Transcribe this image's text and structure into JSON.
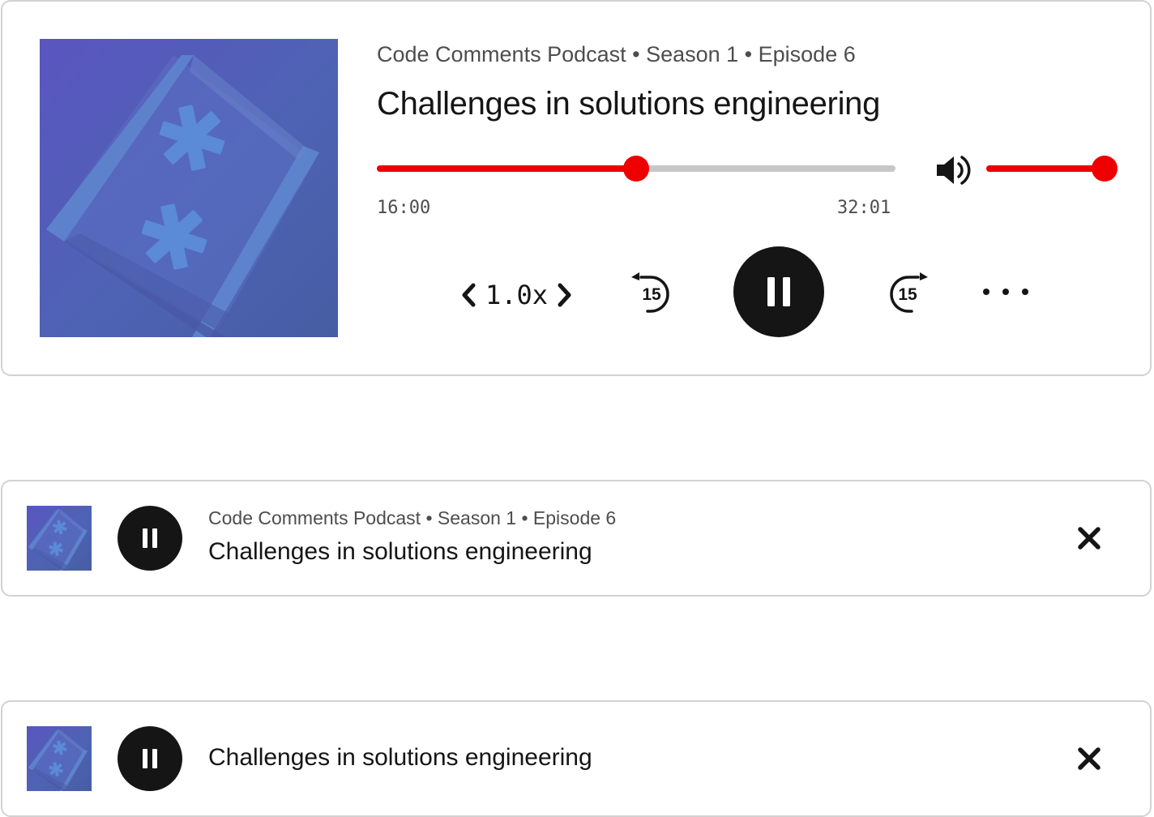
{
  "colors": {
    "accent": "#ee0000",
    "track": "#c7c7c7",
    "button": "#151515",
    "border": "#d2d2d2",
    "muted_text": "#4d4d4d"
  },
  "episode": {
    "meta": "Code Comments Podcast • Season 1 • Episode 6",
    "title": "Challenges in solutions engineering",
    "artwork_icon": "code-comments-artwork-icon"
  },
  "full_player": {
    "current_time": "16:00",
    "total_time": "32:01",
    "progress": 0.5,
    "volume": 1.0,
    "volume_icon": "speaker-icon",
    "playback_rate": "1.0x",
    "rate_decrease_icon": "chevron-left-icon",
    "rate_increase_icon": "chevron-right-icon",
    "seek_back_label": "15",
    "seek_forward_label": "15",
    "play_state_icon": "pause-icon",
    "more_icon": "more-horizontal-icon"
  },
  "compact_player": {
    "meta": "Code Comments Podcast • Season 1 • Episode 6",
    "title": "Challenges in solutions engineering",
    "play_state_icon": "pause-icon",
    "close_icon": "close-icon"
  },
  "mini_player": {
    "title": "Challenges in solutions engineering",
    "play_state_icon": "pause-icon",
    "close_icon": "close-icon"
  }
}
